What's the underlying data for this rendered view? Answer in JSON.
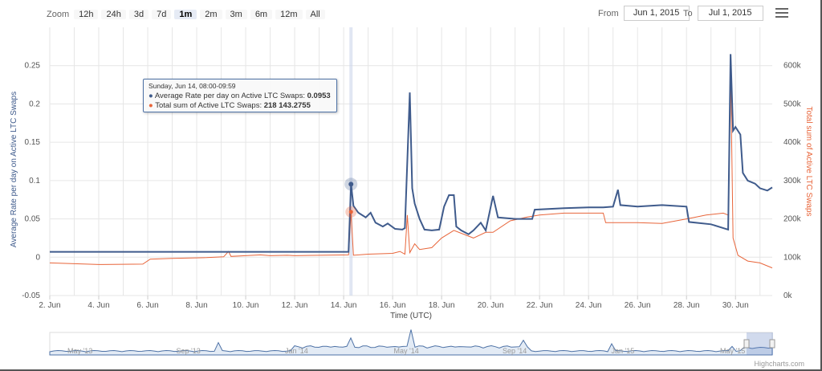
{
  "zoom": {
    "label": "Zoom",
    "buttons": [
      "12h",
      "24h",
      "3d",
      "7d",
      "1m",
      "2m",
      "3m",
      "6m",
      "12m",
      "All"
    ],
    "active": "1m"
  },
  "range": {
    "from_label": "From",
    "from": "Jun 1, 2015",
    "to_label": "To",
    "to": "Jul 1, 2015"
  },
  "tooltip": {
    "header": "Sunday, Jun 14, 08:00-09:59",
    "row1_label": "Average Rate per day on Active LTC Swaps: ",
    "row1_value": "0.0953",
    "row2_label": "Total sum of Active LTC Swaps: ",
    "row2_value": "218 143.2755"
  },
  "credit": "Highcharts.com",
  "colors": {
    "rate": "#3f5b8c",
    "sum": "#e8653a",
    "grid": "#e6e6e6",
    "nav": "#4e72a6"
  },
  "chart_data": {
    "type": "line",
    "title": "",
    "xlabel": "Time (UTC)",
    "x_tick_labels": [
      "2. Jun",
      "4. Jun",
      "6. Jun",
      "8. Jun",
      "10. Jun",
      "12. Jun",
      "14. Jun",
      "16. Jun",
      "18. Jun",
      "20. Jun",
      "22. Jun",
      "24. Jun",
      "26. Jun",
      "28. Jun",
      "30. Jun"
    ],
    "xlim": [
      2,
      31.5
    ],
    "y_left": {
      "label": "Average Rate per day on Active LTC Swaps",
      "ticks": [
        "-0.05",
        "0",
        "0.05",
        "0.1",
        "0.15",
        "0.2",
        "0.25"
      ],
      "lim": [
        -0.05,
        0.3
      ]
    },
    "y_right": {
      "label": "Total sum of Active LTC Swaps",
      "ticks": [
        "0k",
        "100k",
        "200k",
        "300k",
        "400k",
        "500k",
        "600k"
      ],
      "lim": [
        0,
        700000
      ]
    },
    "series": [
      {
        "name": "Average Rate per day on Active LTC Swaps",
        "axis": "left",
        "points": [
          [
            2,
            0.007
          ],
          [
            6,
            0.007
          ],
          [
            10,
            0.007
          ],
          [
            13,
            0.007
          ],
          [
            14.2,
            0.007
          ],
          [
            14.3,
            0.0953
          ],
          [
            14.4,
            0.067
          ],
          [
            14.6,
            0.058
          ],
          [
            14.9,
            0.052
          ],
          [
            15.1,
            0.058
          ],
          [
            15.3,
            0.045
          ],
          [
            15.6,
            0.04
          ],
          [
            15.8,
            0.044
          ],
          [
            16.1,
            0.037
          ],
          [
            16.4,
            0.036
          ],
          [
            16.5,
            0.038
          ],
          [
            16.7,
            0.215
          ],
          [
            16.8,
            0.09
          ],
          [
            16.9,
            0.07
          ],
          [
            17.1,
            0.05
          ],
          [
            17.3,
            0.036
          ],
          [
            17.6,
            0.035
          ],
          [
            17.9,
            0.036
          ],
          [
            18.1,
            0.066
          ],
          [
            18.3,
            0.081
          ],
          [
            18.5,
            0.081
          ],
          [
            18.6,
            0.04
          ],
          [
            18.8,
            0.035
          ],
          [
            19.1,
            0.03
          ],
          [
            19.3,
            0.035
          ],
          [
            19.6,
            0.045
          ],
          [
            19.8,
            0.035
          ],
          [
            20.1,
            0.08
          ],
          [
            20.3,
            0.052
          ],
          [
            21.0,
            0.05
          ],
          [
            21.7,
            0.05
          ],
          [
            21.8,
            0.062
          ],
          [
            23.0,
            0.064
          ],
          [
            24.0,
            0.065
          ],
          [
            24.6,
            0.065
          ],
          [
            25.0,
            0.066
          ],
          [
            25.2,
            0.088
          ],
          [
            25.3,
            0.068
          ],
          [
            26.0,
            0.066
          ],
          [
            27.0,
            0.068
          ],
          [
            28.0,
            0.066
          ],
          [
            28.1,
            0.046
          ],
          [
            29.0,
            0.043
          ],
          [
            29.7,
            0.036
          ],
          [
            29.8,
            0.265
          ],
          [
            29.9,
            0.165
          ],
          [
            30.0,
            0.17
          ],
          [
            30.2,
            0.16
          ],
          [
            30.3,
            0.11
          ],
          [
            30.5,
            0.1
          ],
          [
            30.8,
            0.096
          ],
          [
            31.0,
            0.09
          ],
          [
            31.3,
            0.087
          ],
          [
            31.5,
            0.091
          ]
        ]
      },
      {
        "name": "Total sum of Active LTC Swaps",
        "axis": "right",
        "points": [
          [
            2,
            85000
          ],
          [
            4,
            81000
          ],
          [
            5.8,
            82000
          ],
          [
            6.1,
            95000
          ],
          [
            7,
            97000
          ],
          [
            8.4,
            99000
          ],
          [
            9.1,
            101000
          ],
          [
            9.3,
            115000
          ],
          [
            9.4,
            102000
          ],
          [
            10,
            104000
          ],
          [
            10.6,
            106000
          ],
          [
            11,
            104000
          ],
          [
            11.7,
            105000
          ],
          [
            12,
            104000
          ],
          [
            13,
            105000
          ],
          [
            14.2,
            106000
          ],
          [
            14.3,
            218143
          ],
          [
            14.4,
            105000
          ],
          [
            15,
            108000
          ],
          [
            16,
            110000
          ],
          [
            16.3,
            115000
          ],
          [
            16.5,
            108000
          ],
          [
            16.6,
            210000
          ],
          [
            16.7,
            112000
          ],
          [
            16.9,
            135000
          ],
          [
            17.1,
            120000
          ],
          [
            17.6,
            125000
          ],
          [
            18.0,
            150000
          ],
          [
            18.5,
            170000
          ],
          [
            19.3,
            150000
          ],
          [
            19.8,
            165000
          ],
          [
            20.1,
            165000
          ],
          [
            20.8,
            195000
          ],
          [
            21.5,
            205000
          ],
          [
            22,
            210000
          ],
          [
            23,
            215000
          ],
          [
            24,
            215000
          ],
          [
            24.6,
            215000
          ],
          [
            24.7,
            190000
          ],
          [
            26,
            190000
          ],
          [
            27,
            188000
          ],
          [
            28.0,
            200000
          ],
          [
            28.4,
            205000
          ],
          [
            28.8,
            210000
          ],
          [
            29.5,
            215000
          ],
          [
            29.7,
            210000
          ],
          [
            29.8,
            600000
          ],
          [
            29.9,
            150000
          ],
          [
            30.1,
            105000
          ],
          [
            30.5,
            90000
          ],
          [
            31,
            85000
          ],
          [
            31.5,
            72000
          ]
        ]
      }
    ],
    "highlight_x": 14.3,
    "navigator": {
      "labels": [
        "May '13",
        "Sep '13",
        "Jan '14",
        "May '14",
        "Sep '14",
        "Jan '15",
        "May '15"
      ]
    }
  }
}
